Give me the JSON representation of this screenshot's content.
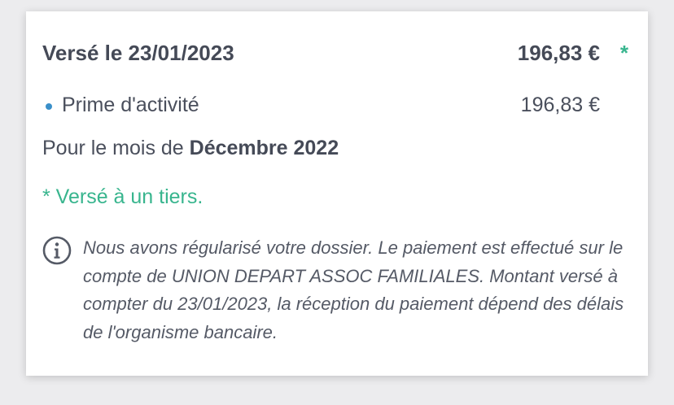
{
  "payment": {
    "title": "Versé le 23/01/2023",
    "amount": "196,83 €",
    "star": "*"
  },
  "item": {
    "label": "Prime d'activité",
    "amount": "196,83 €"
  },
  "month": {
    "prefix": "Pour le mois de ",
    "value": "Décembre 2022"
  },
  "note": "* Versé à un tiers.",
  "info": {
    "icon": "info-icon",
    "text": "Nous avons régularisé votre dossier. Le paiement est effectué sur le compte de UNION DEPART ASSOC FAMILIALES. Montant versé à compter du 23/01/2023, la réception du paiement dépend des délais de l'organisme bancaire."
  },
  "colors": {
    "accent_green": "#38b58e",
    "bullet_blue": "#3a8fc9",
    "text": "#4a4f5c"
  }
}
